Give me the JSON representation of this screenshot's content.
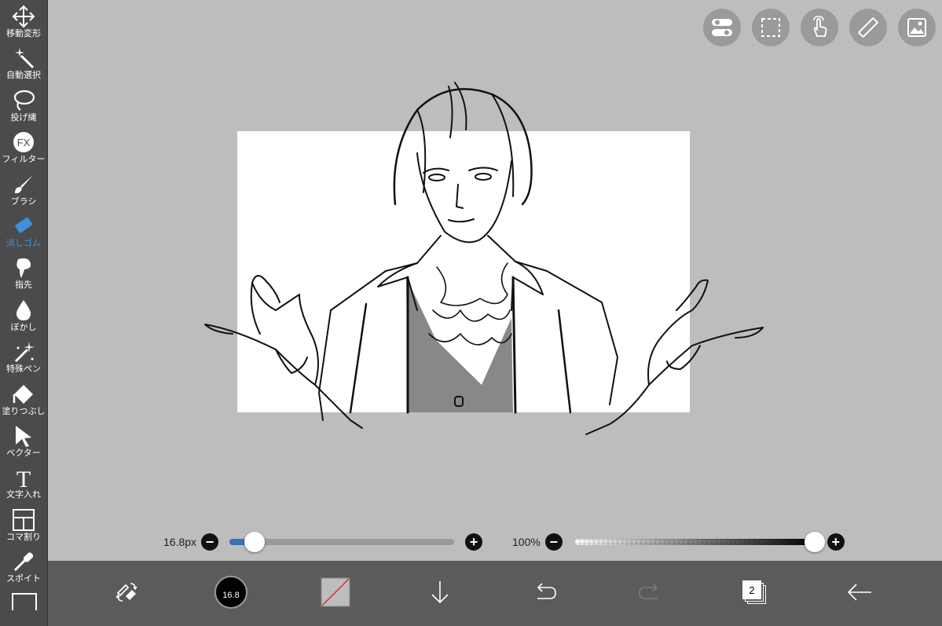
{
  "sidebar": {
    "tools": [
      {
        "label": "移動変形",
        "icon": "move-transform-icon"
      },
      {
        "label": "自動選択",
        "icon": "magic-wand-icon"
      },
      {
        "label": "投げ縄",
        "icon": "lasso-icon"
      },
      {
        "label": "フィルター",
        "icon": "fx-filter-icon",
        "badge": "FX"
      },
      {
        "label": "ブラシ",
        "icon": "brush-icon"
      },
      {
        "label": "消しゴム",
        "icon": "eraser-icon",
        "active": true
      },
      {
        "label": "指先",
        "icon": "finger-smudge-icon"
      },
      {
        "label": "ぼかし",
        "icon": "blur-drop-icon"
      },
      {
        "label": "特殊ペン",
        "icon": "special-pen-icon"
      },
      {
        "label": "塗りつぶし",
        "icon": "fill-bucket-icon"
      },
      {
        "label": "ベクター",
        "icon": "vector-cursor-icon"
      },
      {
        "label": "文字入れ",
        "icon": "text-icon",
        "badge": "T"
      },
      {
        "label": "コマ割り",
        "icon": "frame-divider-icon"
      },
      {
        "label": "スポイト",
        "icon": "eyedropper-icon"
      }
    ],
    "active_color": "#3d8fe0"
  },
  "top_toolbar": [
    {
      "icon": "toggle-settings-icon"
    },
    {
      "icon": "selection-rect-icon"
    },
    {
      "icon": "touch-gesture-icon"
    },
    {
      "icon": "ruler-icon"
    },
    {
      "icon": "image-material-icon"
    }
  ],
  "brush_size": {
    "value_label": "16.8px",
    "level": 0.11
  },
  "opacity": {
    "value_label": "100%",
    "level": 1.0
  },
  "bottom_bar": {
    "brush_size_badge": "16.8",
    "layer_count": "2",
    "items": [
      "swap-tools-icon",
      "brush-size-icon",
      "color-swatch-icon",
      "download-arrow-icon",
      "undo-icon",
      "redo-icon",
      "layers-icon",
      "back-arrow-icon"
    ]
  }
}
